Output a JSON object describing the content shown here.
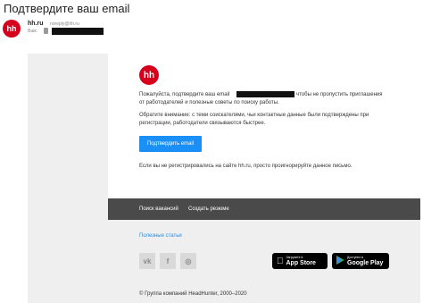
{
  "email": {
    "subject": "Подтвердите ваш email",
    "sender_avatar": "hh",
    "sender_name": "hh.ru",
    "sender_email": "noreply@hh.ru",
    "to_label": "Вам:"
  },
  "body": {
    "logo": "hh",
    "line1_a": "Пожалуйста, подтвердите ваш email",
    "line1_b": "чтобы не пропустить приглашения",
    "line2": "от работодателей и полезные советы по поиску работы.",
    "note1": "Обратите внимание: с теми соискателями, чьи контактные данные были подтверждены при",
    "note2": "регистрации, работодатели связываются быстрее.",
    "confirm_button": "Подтвердить email",
    "ignore_text": "Если вы не регистрировались на сайте hh.ru, просто проигнорируйте данное письмо."
  },
  "footer": {
    "link_vacancies": "Поиск вакансий",
    "link_resume": "Создать резюме",
    "useful_articles": "Полезные статьи",
    "social": [
      {
        "name": "vk-icon",
        "glyph": "vk"
      },
      {
        "name": "facebook-icon",
        "glyph": "f"
      },
      {
        "name": "instagram-icon",
        "glyph": "◎"
      }
    ],
    "appstore": {
      "small": "Загрузите в",
      "big": "App Store",
      "icon": "apple-icon"
    },
    "googleplay": {
      "small": "Доступно в",
      "big": "Google Play",
      "icon": "google-play-icon"
    },
    "copyright": "© Группа компаний HeadHunter, 2000–2020"
  },
  "colors": {
    "brand": "#d6001c",
    "button": "#1a8ff5",
    "footer_bar": "#4a4a4a"
  }
}
